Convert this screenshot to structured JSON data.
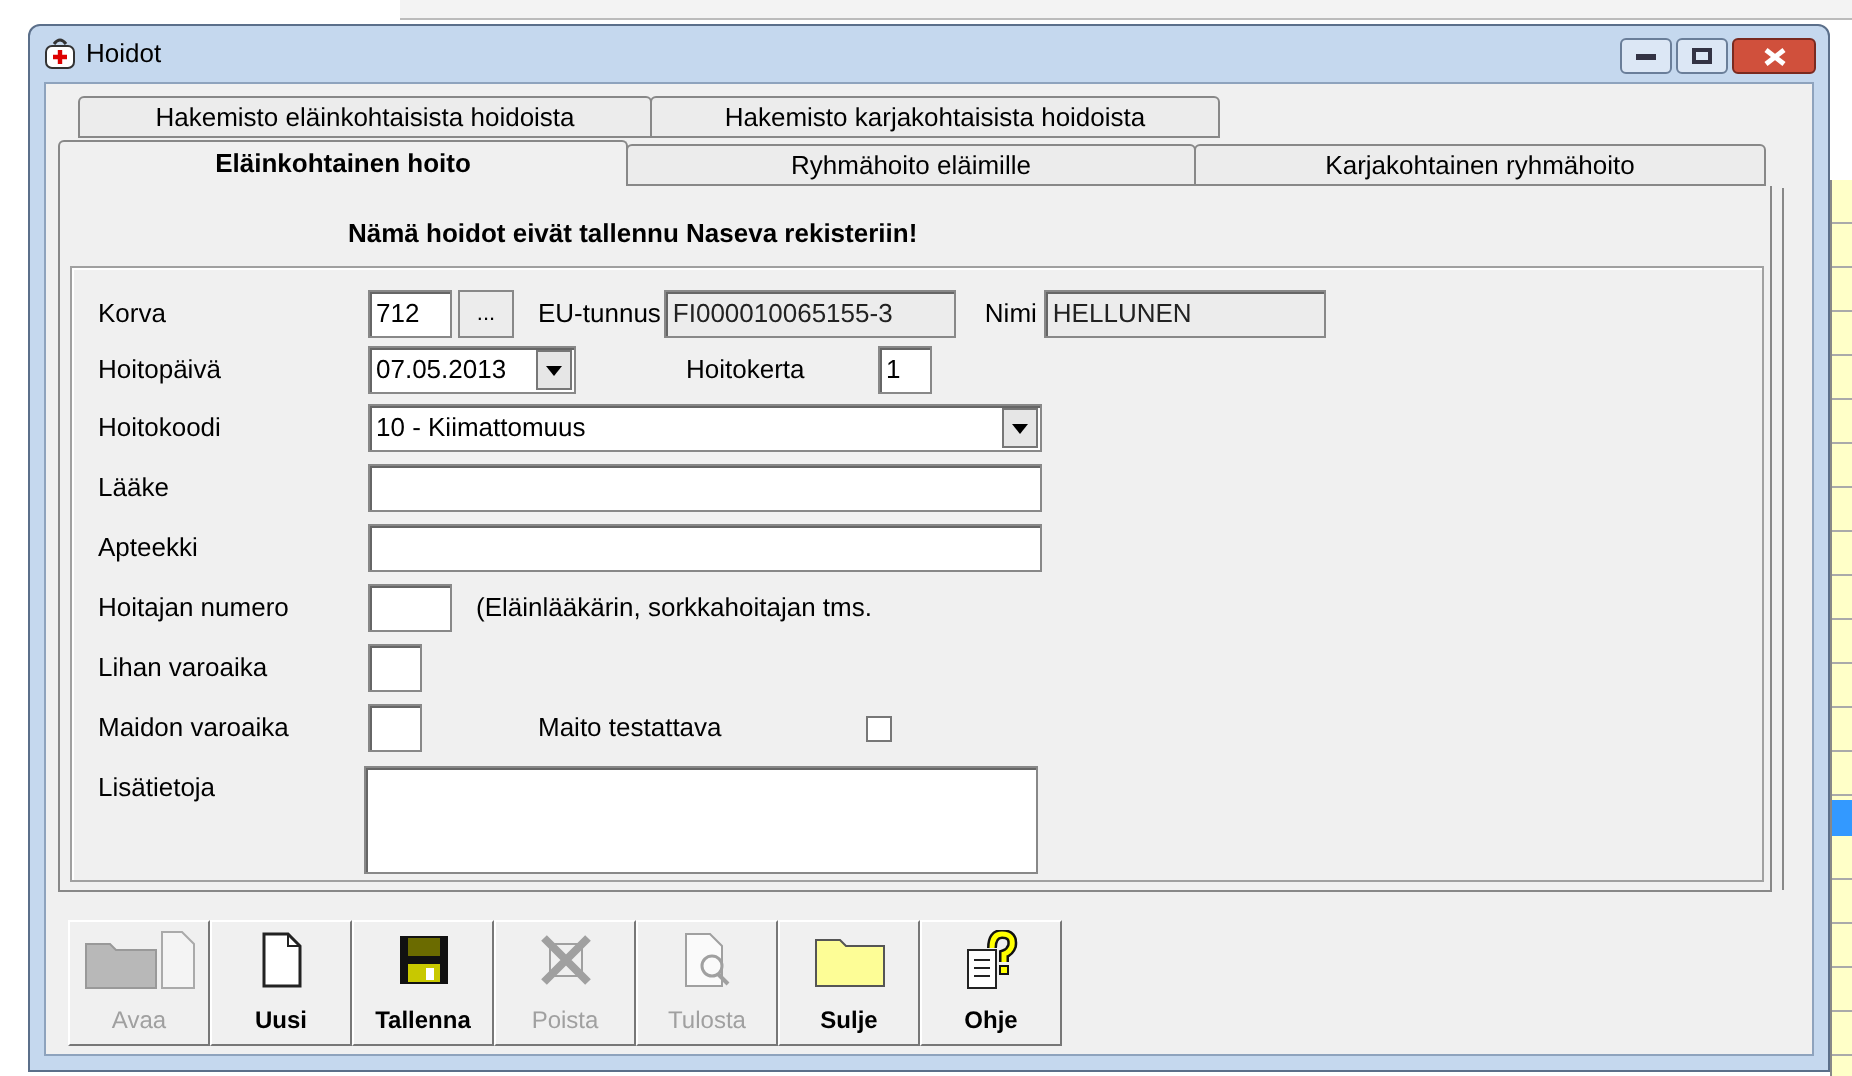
{
  "window": {
    "title": "Hoidot"
  },
  "tab_rows": [
    [
      {
        "label": "Hakemisto eläinkohtaisista hoidoista",
        "selected": false
      },
      {
        "label": "Hakemisto karjakohtaisista hoidoista",
        "selected": false
      }
    ],
    [
      {
        "label": "Eläinkohtainen hoito",
        "selected": true
      },
      {
        "label": "Ryhmähoito eläimille",
        "selected": false
      },
      {
        "label": "Karjakohtainen ryhmähoito",
        "selected": false
      }
    ]
  ],
  "notice": "Nämä hoidot eivät tallennu Naseva rekisteriin!",
  "form": {
    "ear_tag": {
      "label": "Korva",
      "value": "712",
      "browse_button": "..."
    },
    "eu_id": {
      "label": "EU-tunnus",
      "value": "FI000010065155-3",
      "disabled": true
    },
    "name": {
      "label": "Nimi",
      "value": "HELLUNEN",
      "disabled": true
    },
    "treatment_date": {
      "label": "Hoitopäivä",
      "value": "07.05.2013"
    },
    "treatment_count": {
      "label": "Hoitokerta",
      "value": "1"
    },
    "treatment_code": {
      "label": "Hoitokoodi",
      "value": "10 - Kiimattomuus"
    },
    "medicine": {
      "label": "Lääke"
    },
    "pharmacy": {
      "label": "Apteekki"
    },
    "caretaker_number": {
      "label": "Hoitajan numero",
      "note": "(Eläinlääkärin, sorkkahoitajan tms."
    },
    "meat_withdrawal": {
      "label": "Lihan varoaika"
    },
    "milk_withdrawal": {
      "label": "Maidon varoaika"
    },
    "milk_tested": {
      "label": "Maito testattava",
      "checked": false
    },
    "notes": {
      "label": "Lisätietoja"
    }
  },
  "toolbar": [
    {
      "kind": "open",
      "label": "Avaa",
      "disabled": true
    },
    {
      "kind": "new",
      "label": "Uusi",
      "disabled": false
    },
    {
      "kind": "save",
      "label": "Tallenna",
      "disabled": false
    },
    {
      "kind": "delete",
      "label": "Poista",
      "disabled": true
    },
    {
      "kind": "print",
      "label": "Tulosta",
      "disabled": true
    },
    {
      "kind": "close",
      "label": "Sulje",
      "disabled": false
    },
    {
      "kind": "help",
      "label": "Ohje",
      "disabled": false
    }
  ]
}
